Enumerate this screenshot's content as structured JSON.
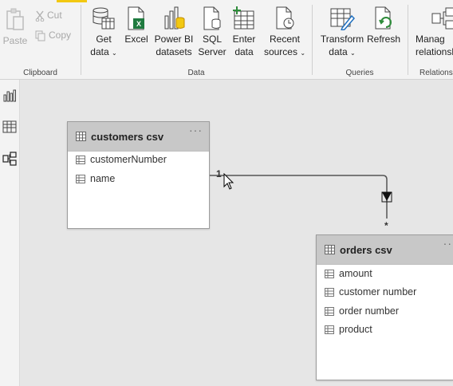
{
  "ribbon": {
    "clipboard": {
      "label": "Clipboard",
      "paste": "Paste",
      "cut": "Cut",
      "copy": "Copy"
    },
    "data": {
      "label": "Data",
      "get_data": [
        "Get",
        "data"
      ],
      "excel": "Excel",
      "power_bi": [
        "Power BI",
        "datasets"
      ],
      "sql": [
        "SQL",
        "Server"
      ],
      "enter": [
        "Enter",
        "data"
      ],
      "recent": [
        "Recent",
        "sources"
      ]
    },
    "queries": {
      "label": "Queries",
      "transform": [
        "Transform",
        "data"
      ],
      "refresh": "Refresh"
    },
    "relationships": {
      "label": "Relationshi",
      "manage": [
        "Manag",
        "relationsh"
      ]
    },
    "chevron": "⌄"
  },
  "tables": {
    "customers": {
      "title": "customers csv",
      "more": "···",
      "fields": [
        "customerNumber",
        "name"
      ]
    },
    "orders": {
      "title": "orders csv",
      "more": "··",
      "fields": [
        "amount",
        "customer number",
        "order number",
        "product"
      ]
    }
  },
  "relationship": {
    "from_cardinality": "1",
    "to_cardinality": "*"
  },
  "colors": {
    "accent": "#f2c811",
    "excel_green": "#1f7a3f",
    "refresh_green": "#2e8b3a",
    "icon_dark": "#444444"
  },
  "icons": {
    "rail": [
      "report-view-icon",
      "data-view-icon",
      "model-view-icon"
    ]
  }
}
